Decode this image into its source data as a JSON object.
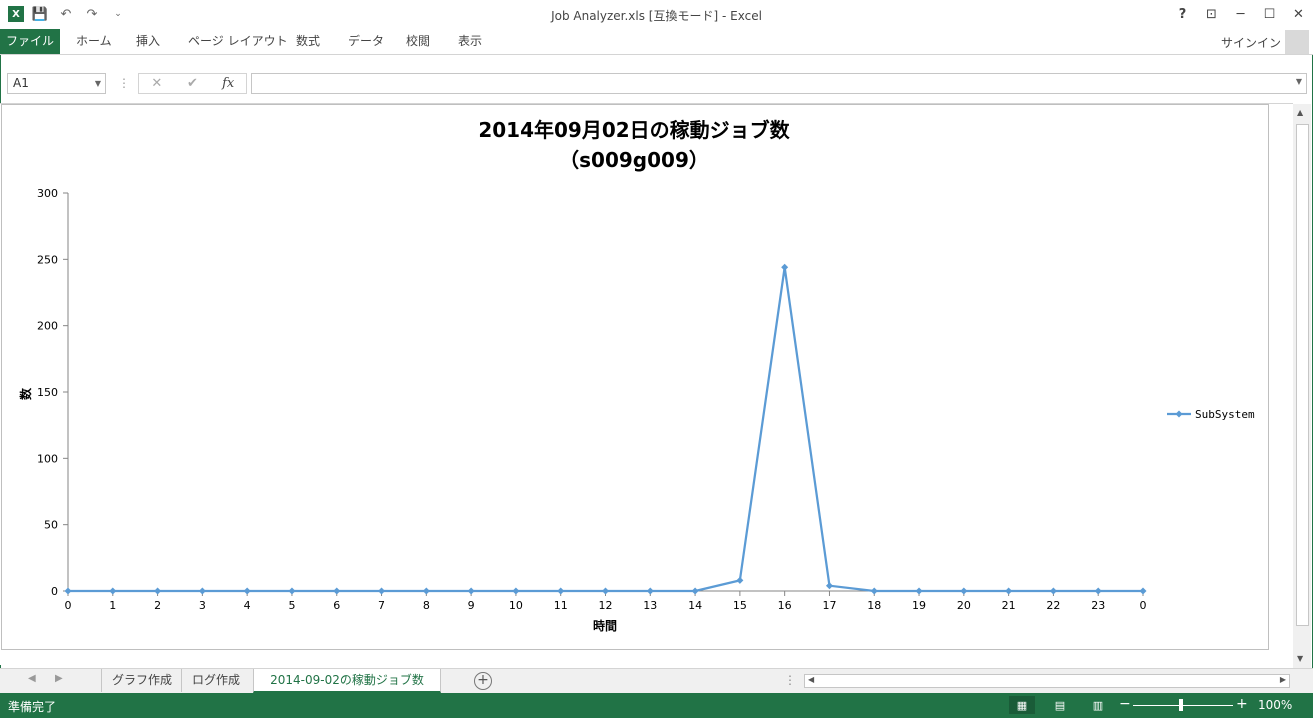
{
  "window": {
    "title": "Job Analyzer.xls  [互換モード] - Excel",
    "help": "?",
    "ribbon_display": "⊡",
    "minimize": "─",
    "maximize": "☐",
    "close": "✕"
  },
  "qat": {
    "logo": "X",
    "save": "💾",
    "undo": "↶",
    "redo": "↷",
    "customize": "⌄"
  },
  "ribbon": {
    "file": "ファイル",
    "tabs": [
      "ホーム",
      "挿入",
      "ページ レイアウト",
      "数式",
      "データ",
      "校閲",
      "表示"
    ],
    "signin": "サインイン"
  },
  "formula_bar": {
    "name_box": "A1",
    "cancel": "✕",
    "enter": "✔",
    "fx": "fx",
    "value": ""
  },
  "chart_data": {
    "type": "line",
    "title": "2014年09月02日の稼動ジョブ数",
    "subtitle": "（s009g009）",
    "xlabel": "時間",
    "ylabel": "数",
    "categories": [
      "0",
      "1",
      "2",
      "3",
      "4",
      "5",
      "6",
      "7",
      "8",
      "9",
      "10",
      "11",
      "12",
      "13",
      "14",
      "15",
      "16",
      "17",
      "18",
      "19",
      "20",
      "21",
      "22",
      "23",
      "0"
    ],
    "yticks": [
      0,
      50,
      100,
      150,
      200,
      250,
      300
    ],
    "ylim": [
      0,
      300
    ],
    "series": [
      {
        "name": "SubSystem",
        "color": "#5b9bd5",
        "values": [
          0,
          0,
          0,
          0,
          0,
          0,
          0,
          0,
          0,
          0,
          0,
          0,
          0,
          0,
          0,
          8,
          244,
          4,
          0,
          0,
          0,
          0,
          0,
          0,
          0
        ]
      }
    ],
    "legend_position": "right",
    "grid": false
  },
  "sheet_tabs": {
    "tabs": [
      "グラフ作成",
      "ログ作成",
      "2014-09-02の稼動ジョブ数"
    ],
    "active": 2,
    "add": "+"
  },
  "status": {
    "ready": "準備完了",
    "zoom": "100%",
    "zoom_level": 1.0
  }
}
